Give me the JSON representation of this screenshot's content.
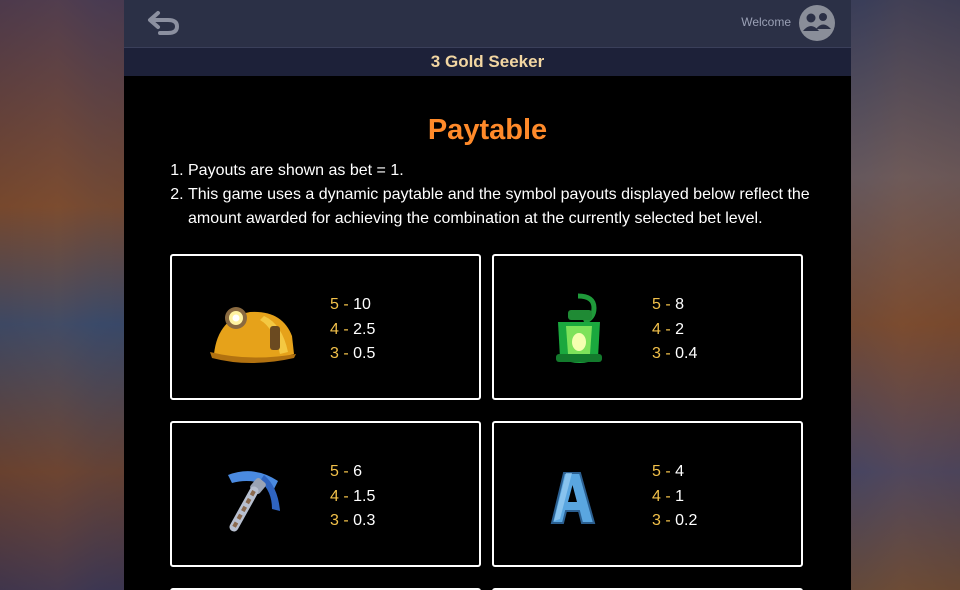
{
  "header": {
    "welcome_label": "Welcome"
  },
  "game_title": "3 Gold Seeker",
  "heading": "Paytable",
  "rules": [
    "Payouts are shown as bet = 1.",
    "This game uses a dynamic paytable and the symbol payouts displayed below reflect the amount awarded for achieving the combination at the currently selected bet level."
  ],
  "colors": {
    "heading": "#ff8a2a",
    "title": "#f2d6a2",
    "count": "#f2c14a"
  },
  "symbols": [
    {
      "icon": "miner-helmet-icon",
      "pays": [
        {
          "count": "5 -",
          "value": "10"
        },
        {
          "count": "4 -",
          "value": "2.5"
        },
        {
          "count": "3 -",
          "value": "0.5"
        }
      ]
    },
    {
      "icon": "lantern-icon",
      "pays": [
        {
          "count": "5 -",
          "value": "8"
        },
        {
          "count": "4 -",
          "value": "2"
        },
        {
          "count": "3 -",
          "value": "0.4"
        }
      ]
    },
    {
      "icon": "pickaxe-icon",
      "pays": [
        {
          "count": "5 -",
          "value": "6"
        },
        {
          "count": "4 -",
          "value": "1.5"
        },
        {
          "count": "3 -",
          "value": "0.3"
        }
      ]
    },
    {
      "icon": "letter-a-icon",
      "pays": [
        {
          "count": "5 -",
          "value": "4"
        },
        {
          "count": "4 -",
          "value": "1"
        },
        {
          "count": "3 -",
          "value": "0.2"
        }
      ]
    }
  ]
}
